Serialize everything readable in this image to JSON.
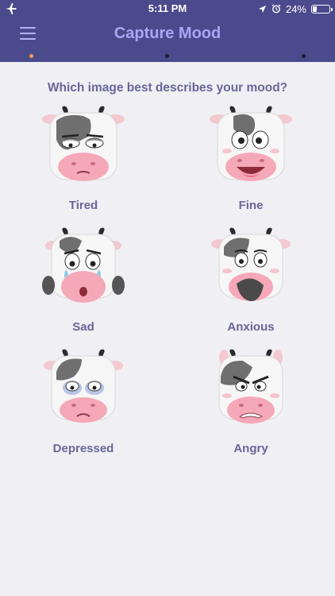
{
  "status_bar": {
    "time": "5:11 PM",
    "battery_text": "24%",
    "battery_level": 0.24,
    "icons": [
      "airplane-icon",
      "location-arrow-icon",
      "alarm-icon",
      "battery-icon"
    ]
  },
  "header": {
    "title": "Capture Mood",
    "menu_icon": "hamburger-menu-icon",
    "page_indicator": {
      "count": 3,
      "active_index": 0
    }
  },
  "prompt": "Which image best describes your mood?",
  "moods": [
    {
      "label": "Tired",
      "icon": "tired-cow-icon"
    },
    {
      "label": "Fine",
      "icon": "fine-cow-icon"
    },
    {
      "label": "Sad",
      "icon": "sad-cow-icon"
    },
    {
      "label": "Anxious",
      "icon": "anxious-cow-icon"
    },
    {
      "label": "Depressed",
      "icon": "depressed-cow-icon"
    },
    {
      "label": "Angry",
      "icon": "angry-cow-icon"
    }
  ],
  "colors": {
    "header_bg": "#4b4a8c",
    "title": "#a9a7f3",
    "label_text": "#6a6699",
    "page_bg": "#efeff4",
    "active_dot": "#f29a4b"
  }
}
